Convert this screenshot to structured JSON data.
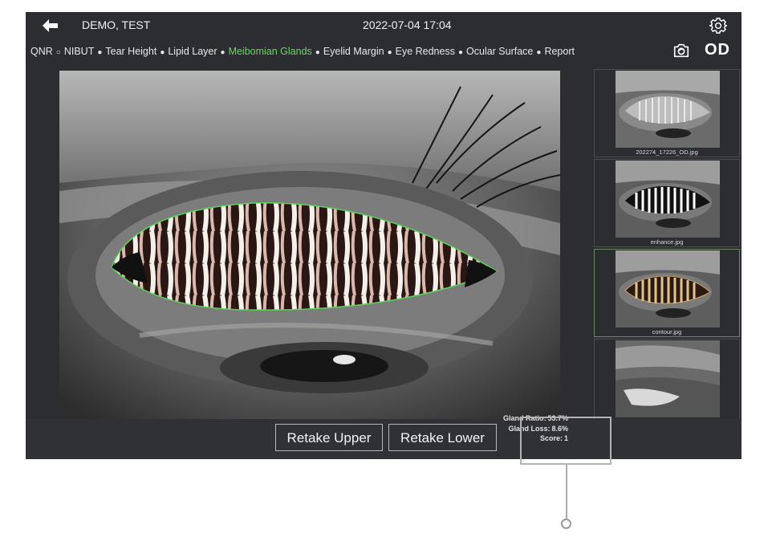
{
  "header": {
    "patient_name": "DEMO, TEST",
    "datetime": "2022-07-04 17:04",
    "eye_side": "OD"
  },
  "nav": {
    "items": [
      {
        "label": "QNR",
        "marker": "○"
      },
      {
        "label": "NIBUT",
        "marker": "●"
      },
      {
        "label": "Tear Height",
        "marker": "●"
      },
      {
        "label": "Lipid Layer",
        "marker": "●"
      },
      {
        "label": "Meibomian Glands",
        "marker": "●",
        "active": true
      },
      {
        "label": "Eyelid Margin",
        "marker": "●"
      },
      {
        "label": "Eye Redness",
        "marker": "●"
      },
      {
        "label": "Ocular Surface",
        "marker": "●"
      },
      {
        "label": "Report",
        "marker": ""
      }
    ],
    "active_color": "#6fd56a"
  },
  "thumbnails": [
    {
      "caption": "202274_17226_OD.jpg"
    },
    {
      "caption": "enhance.jpg"
    },
    {
      "caption": "contour.jpg",
      "selected": true
    },
    {
      "caption": ""
    }
  ],
  "actions": {
    "retake_upper": "Retake Upper",
    "retake_lower": "Retake Lower"
  },
  "stats": {
    "gland_ratio_label": "Gland Ratio:",
    "gland_ratio_value": "53.7%",
    "gland_loss_label": "Gland Loss:",
    "gland_loss_value": "8.6%",
    "score_label": "Score:",
    "score_value": "1"
  },
  "icons": {
    "back": "arrow-left-icon",
    "settings": "gear-icon",
    "capture": "camera-icon"
  }
}
